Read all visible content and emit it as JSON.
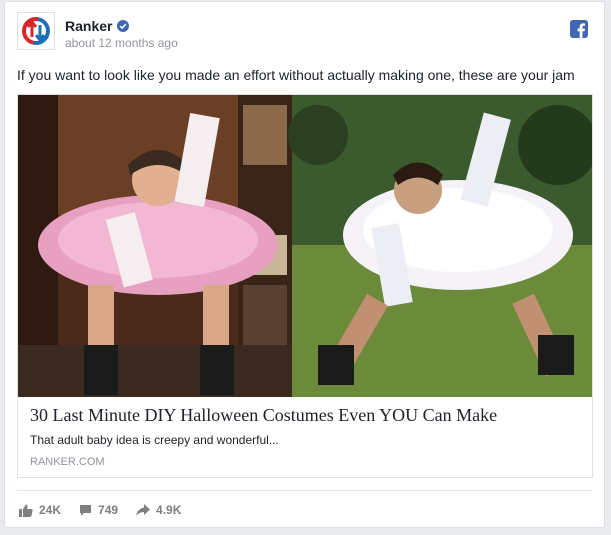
{
  "post": {
    "page_name": "Ranker",
    "timestamp": "about 12 months ago",
    "text": "If you want to look like you made an effort without actually making one, these are your jam"
  },
  "link": {
    "title": "30 Last Minute DIY Halloween Costumes Even YOU Can Make",
    "description": "That adult baby idea is creepy and wonderful...",
    "domain": "RANKER.COM"
  },
  "stats": {
    "likes": "24K",
    "comments": "749",
    "shares": "4.9K"
  },
  "icons": {
    "avatar": "ranker-logo-icon",
    "verified": "verified-badge-icon",
    "network": "facebook-icon",
    "like": "thumbs-up-icon",
    "comment": "comment-icon",
    "share": "share-arrow-icon"
  },
  "colors": {
    "accent": "#4267b2",
    "brand_red": "#d9252a",
    "brand_blue": "#1d6fb8",
    "muted": "#90949c"
  }
}
